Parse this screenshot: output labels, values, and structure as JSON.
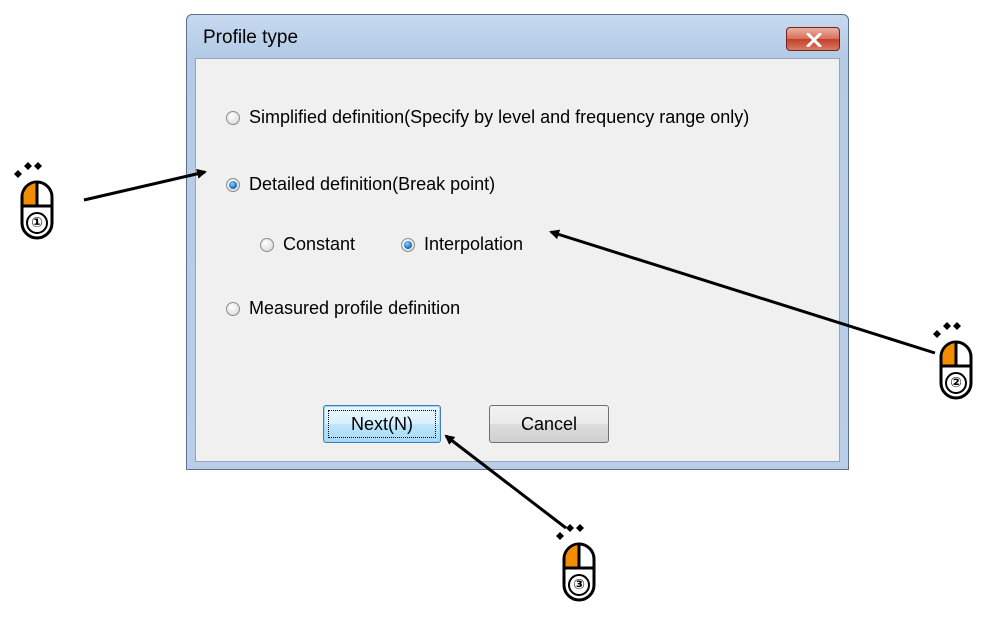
{
  "dialog": {
    "title": "Profile type",
    "options": {
      "simplified": "Simplified definition(Specify by level and frequency range only)",
      "detailed": "Detailed definition(Break point)",
      "constant": "Constant",
      "interpolation": "Interpolation",
      "measured": "Measured profile definition"
    },
    "selected": {
      "definition": "Detailed definition(Break point)",
      "mode": "Interpolation"
    },
    "buttons": {
      "next": "Next(N)",
      "cancel": "Cancel"
    }
  },
  "callouts": [
    {
      "step": "①",
      "target": "Detailed definition(Break point)"
    },
    {
      "step": "②",
      "target": "Interpolation"
    },
    {
      "step": "③",
      "target": "Next(N)"
    }
  ],
  "colors": {
    "mouse_button": "#f28c00",
    "radio_selected": "#1c74c4",
    "title_bar": "#c6d9f0",
    "close_button": "#d66e57"
  },
  "icons": [
    "close-icon",
    "mouse-icon"
  ]
}
